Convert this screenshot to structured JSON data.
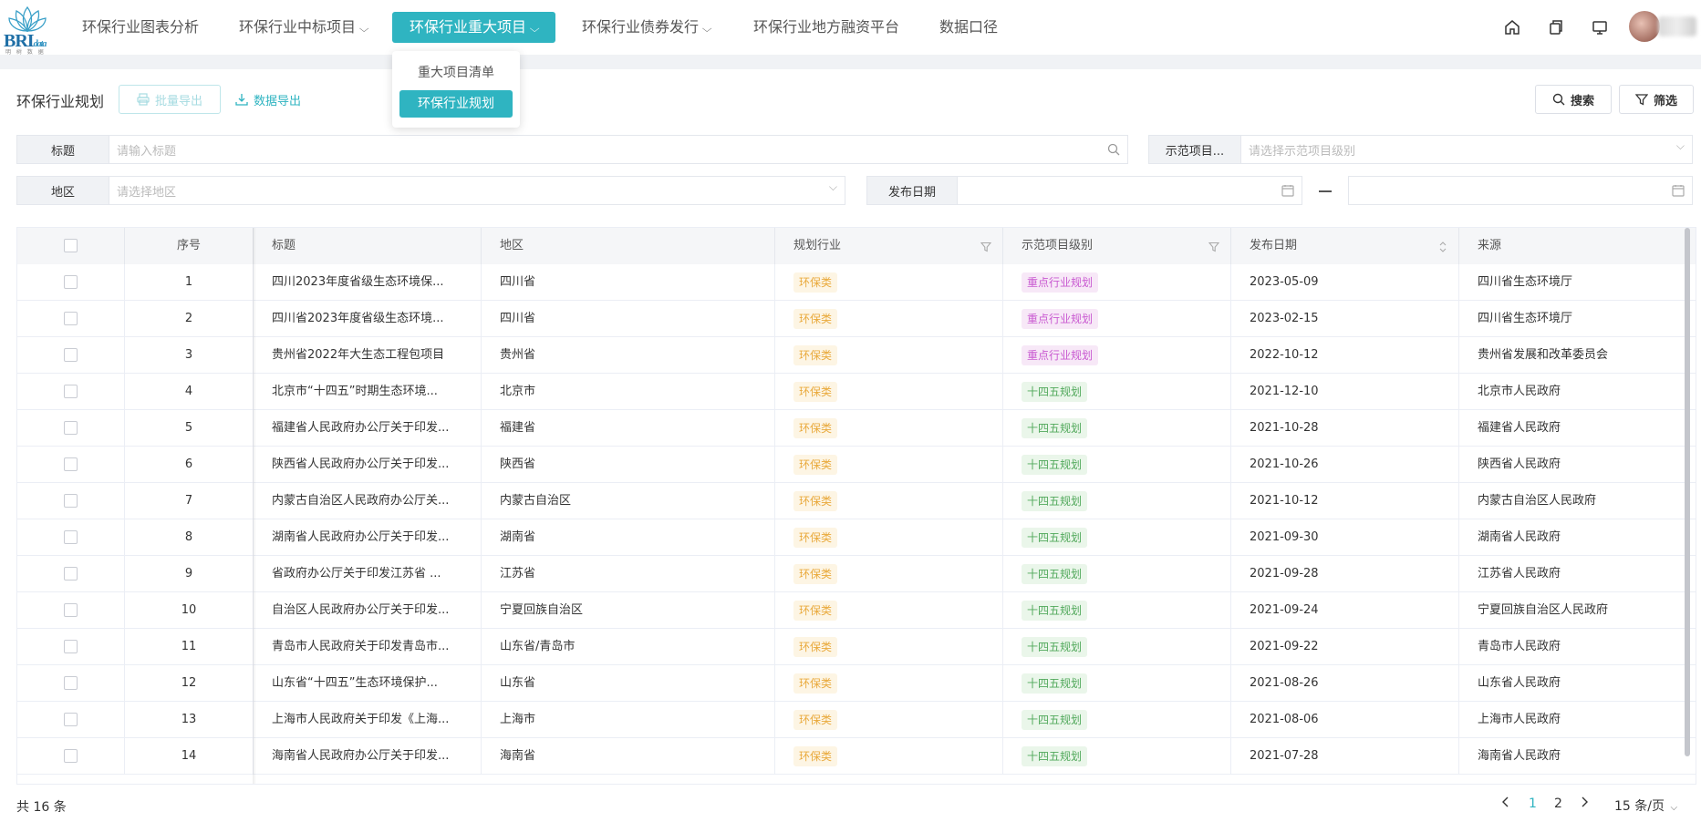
{
  "nav": {
    "brand": "BRI",
    "brand_sub": "data",
    "brand_tagline": "明 树 数 据",
    "items": [
      {
        "label": "环保行业图表分析",
        "has_menu": false
      },
      {
        "label": "环保行业中标项目",
        "has_menu": true
      },
      {
        "label": "环保行业重大项目",
        "has_menu": true,
        "active": true
      },
      {
        "label": "环保行业债券发行",
        "has_menu": true
      },
      {
        "label": "环保行业地方融资平台",
        "has_menu": false
      },
      {
        "label": "数据口径",
        "has_menu": false
      }
    ],
    "icons": [
      "home-icon",
      "copy-icon",
      "monitor-icon"
    ],
    "dropdown": [
      {
        "label": "重大项目清单",
        "selected": false
      },
      {
        "label": "环保行业规划",
        "selected": true
      }
    ]
  },
  "toolbar": {
    "title": "环保行业规划",
    "batch_export": "批量导出",
    "data_export": "数据导出",
    "search": "搜索",
    "filter": "筛选"
  },
  "filters": {
    "title_label": "标题",
    "title_placeholder": "请输入标题",
    "level_label": "示范项目...",
    "level_placeholder": "请选择示范项目级别",
    "region_label": "地区",
    "region_placeholder": "请选择地区",
    "date_label": "发布日期"
  },
  "table": {
    "headers": [
      "序号",
      "标题",
      "地区",
      "规划行业",
      "示范项目级别",
      "发布日期",
      "来源"
    ],
    "rows": [
      {
        "no": "1",
        "title": "四川2023年度省级生态环境保...",
        "region": "四川省",
        "industry": "环保类",
        "level": "重点行业规划",
        "level_type": "key",
        "date": "2023-05-09",
        "source": "四川省生态环境厅"
      },
      {
        "no": "2",
        "title": "四川省2023年度省级生态环境...",
        "region": "四川省",
        "industry": "环保类",
        "level": "重点行业规划",
        "level_type": "key",
        "date": "2023-02-15",
        "source": "四川省生态环境厅"
      },
      {
        "no": "3",
        "title": "贵州省2022年大生态工程包项目",
        "region": "贵州省",
        "industry": "环保类",
        "level": "重点行业规划",
        "level_type": "key",
        "date": "2022-10-12",
        "source": "贵州省发展和改革委员会"
      },
      {
        "no": "4",
        "title": "北京市“十四五”时期生态环境...",
        "region": "北京市",
        "industry": "环保类",
        "level": "十四五规划",
        "level_type": "145",
        "date": "2021-12-10",
        "source": "北京市人民政府"
      },
      {
        "no": "5",
        "title": "福建省人民政府办公厅关于印发...",
        "region": "福建省",
        "industry": "环保类",
        "level": "十四五规划",
        "level_type": "145",
        "date": "2021-10-28",
        "source": "福建省人民政府"
      },
      {
        "no": "6",
        "title": "陕西省人民政府办公厅关于印发...",
        "region": "陕西省",
        "industry": "环保类",
        "level": "十四五规划",
        "level_type": "145",
        "date": "2021-10-26",
        "source": "陕西省人民政府"
      },
      {
        "no": "7",
        "title": "内蒙古自治区人民政府办公厅关...",
        "region": "内蒙古自治区",
        "industry": "环保类",
        "level": "十四五规划",
        "level_type": "145",
        "date": "2021-10-12",
        "source": "内蒙古自治区人民政府"
      },
      {
        "no": "8",
        "title": "湖南省人民政府办公厅关于印发...",
        "region": "湖南省",
        "industry": "环保类",
        "level": "十四五规划",
        "level_type": "145",
        "date": "2021-09-30",
        "source": "湖南省人民政府"
      },
      {
        "no": "9",
        "title": "省政府办公厅关于印发江苏省 ...",
        "region": "江苏省",
        "industry": "环保类",
        "level": "十四五规划",
        "level_type": "145",
        "date": "2021-09-28",
        "source": "江苏省人民政府"
      },
      {
        "no": "10",
        "title": "自治区人民政府办公厅关于印发...",
        "region": "宁夏回族自治区",
        "industry": "环保类",
        "level": "十四五规划",
        "level_type": "145",
        "date": "2021-09-24",
        "source": "宁夏回族自治区人民政府"
      },
      {
        "no": "11",
        "title": "青岛市人民政府关于印发青岛市...",
        "region": "山东省/青岛市",
        "industry": "环保类",
        "level": "十四五规划",
        "level_type": "145",
        "date": "2021-09-22",
        "source": "青岛市人民政府"
      },
      {
        "no": "12",
        "title": "山东省“十四五”生态环境保护...",
        "region": "山东省",
        "industry": "环保类",
        "level": "十四五规划",
        "level_type": "145",
        "date": "2021-08-26",
        "source": "山东省人民政府"
      },
      {
        "no": "13",
        "title": "上海市人民政府关于印发《上海...",
        "region": "上海市",
        "industry": "环保类",
        "level": "十四五规划",
        "level_type": "145",
        "date": "2021-08-06",
        "source": "上海市人民政府"
      },
      {
        "no": "14",
        "title": "海南省人民政府办公厅关于印发...",
        "region": "海南省",
        "industry": "环保类",
        "level": "十四五规划",
        "level_type": "145",
        "date": "2021-07-28",
        "source": "海南省人民政府"
      }
    ]
  },
  "footer": {
    "total": "共 16 条",
    "pages": [
      "1",
      "2"
    ],
    "current_page": "1",
    "page_size": "15 条/页"
  },
  "colors": {
    "accent": "#2fb4c1",
    "tag_env": "#e9a93b",
    "tag_key": "#c95ad1",
    "tag_145": "#52a95c"
  }
}
